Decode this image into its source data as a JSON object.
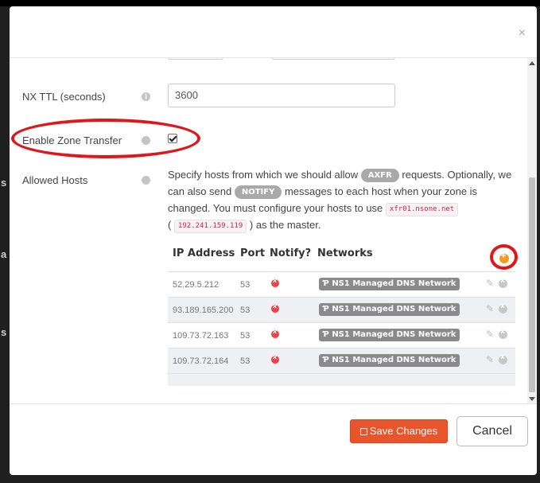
{
  "background_letters": [
    "s",
    "a",
    "s"
  ],
  "close_icon": "×",
  "fields": {
    "nx_ttl": {
      "label": "NX TTL (seconds)",
      "value": "3600"
    },
    "zone_transfer": {
      "label": "Enable Zone Transfer",
      "checked": true
    },
    "allowed_hosts": {
      "label": "Allowed Hosts",
      "desc": {
        "p1": "Specify hosts from which we should allow",
        "pill_axfr": "AXFR",
        "p2": "requests. Optionally, we can also send",
        "pill_notify": "NOTIFY",
        "p3": "messages to each host when your zone is changed. You must configure your hosts to use",
        "code_host": "xfr01.nsone.net",
        "paren_open": "(",
        "code_ip": "192.241.159.119",
        "p4": ") as the master."
      }
    }
  },
  "table": {
    "headers": {
      "ip": "IP Address",
      "port": "Port",
      "notify": "Notify?",
      "networks": "Networks"
    },
    "rows": [
      {
        "ip": "52.29.5.212",
        "port": "53",
        "network": "NS1 Managed DNS Network"
      },
      {
        "ip": "93.189.165.200",
        "port": "53",
        "network": "NS1 Managed DNS Network"
      },
      {
        "ip": "109.73.72.163",
        "port": "53",
        "network": "NS1 Managed DNS Network"
      },
      {
        "ip": "109.73.72.164",
        "port": "53",
        "network": "NS1 Managed DNS Network"
      }
    ]
  },
  "footer": {
    "save_label": "Save Changes",
    "cancel_label": "Cancel"
  },
  "colors": {
    "accent": "#e8542b",
    "highlight": "#e0161b",
    "add": "#f39b1c"
  },
  "icons": [
    "close-icon",
    "info-icon",
    "check-icon",
    "notify-icon",
    "edit-icon",
    "remove-icon",
    "add-icon",
    "save-icon",
    "network-icon"
  ]
}
